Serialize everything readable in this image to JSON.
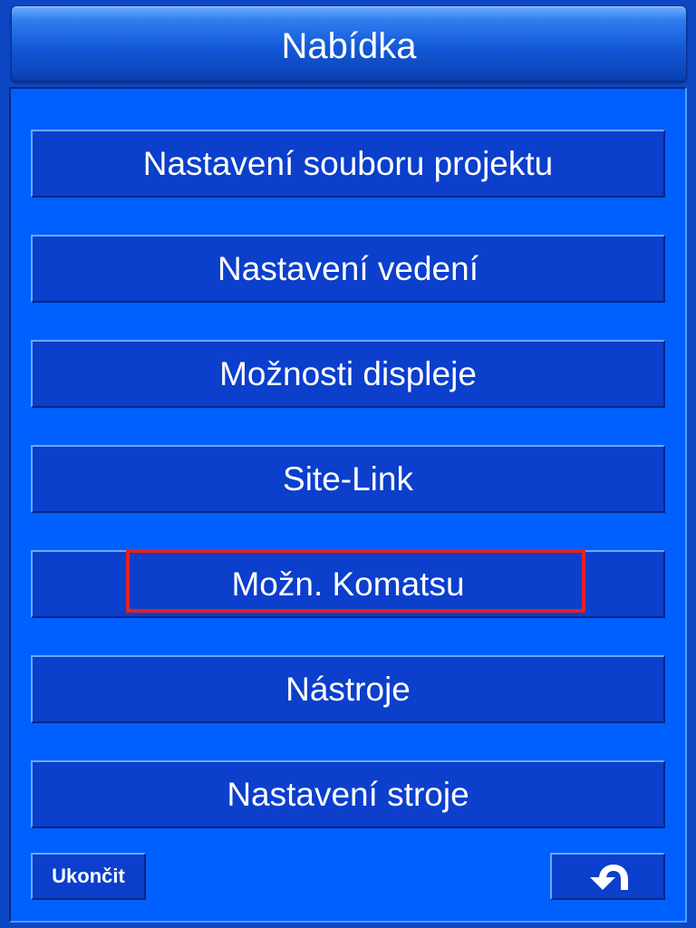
{
  "header": {
    "title": "Nabídka"
  },
  "menu": {
    "items": [
      {
        "label": "Nastavení souboru projektu"
      },
      {
        "label": "Nastavení vedení"
      },
      {
        "label": "Možnosti displeje"
      },
      {
        "label": "Site-Link"
      },
      {
        "label": "Možn. Komatsu",
        "highlighted": true
      },
      {
        "label": "Nástroje"
      },
      {
        "label": "Nastavení stroje"
      }
    ]
  },
  "footer": {
    "exit_label": "Ukončit",
    "back_icon": "undo-arrow-icon"
  },
  "colors": {
    "background": "#0060ff",
    "button": "#0b3fcc",
    "highlight": "#e32222",
    "text": "#ffffff"
  }
}
